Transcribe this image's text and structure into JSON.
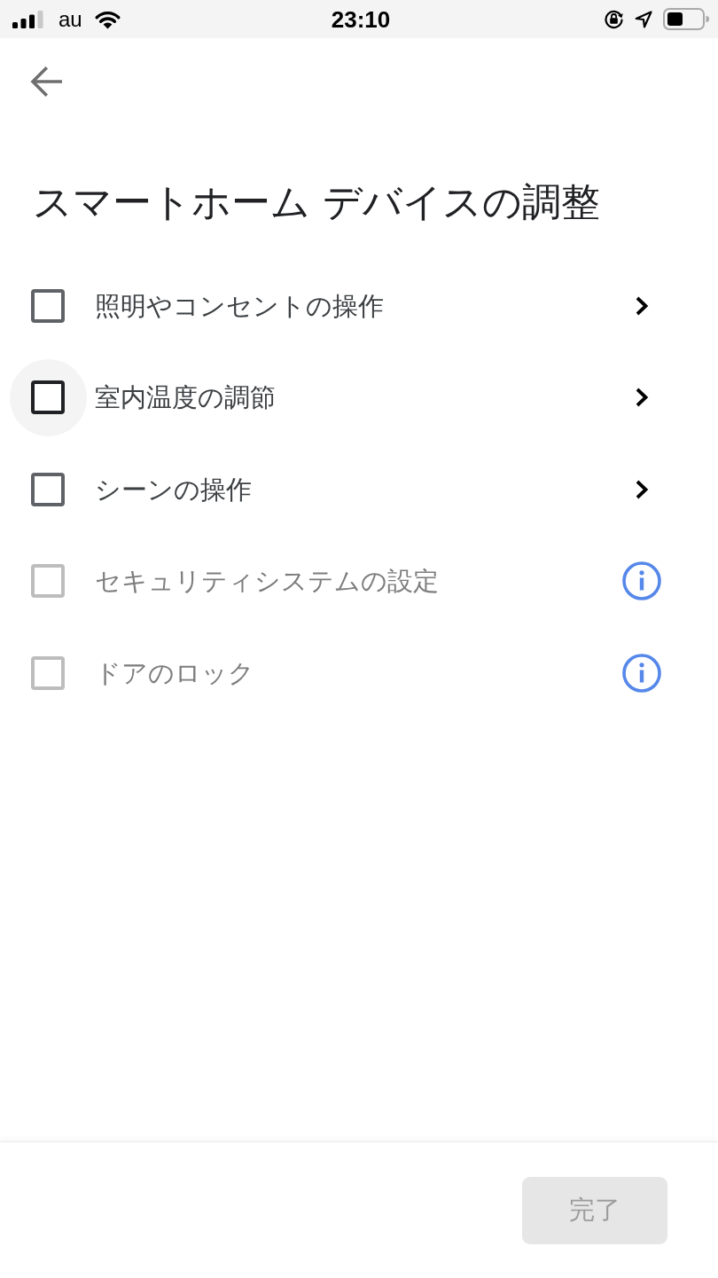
{
  "status_bar": {
    "carrier": "au",
    "time": "23:10"
  },
  "header": {
    "title": "スマートホーム デバイスの調整"
  },
  "options": [
    {
      "label": "照明やコンセントの操作",
      "kind": "submenu",
      "checked": false,
      "focused": false,
      "disabled": false
    },
    {
      "label": "室内温度の調節",
      "kind": "submenu",
      "checked": false,
      "focused": true,
      "disabled": false
    },
    {
      "label": "シーンの操作",
      "kind": "submenu",
      "checked": false,
      "focused": false,
      "disabled": false
    },
    {
      "label": "セキュリティシステムの設定",
      "kind": "info",
      "checked": false,
      "focused": false,
      "disabled": true
    },
    {
      "label": "ドアのロック",
      "kind": "info",
      "checked": false,
      "focused": false,
      "disabled": true
    }
  ],
  "footer": {
    "done_button": {
      "label": "完了",
      "disabled": true
    }
  }
}
